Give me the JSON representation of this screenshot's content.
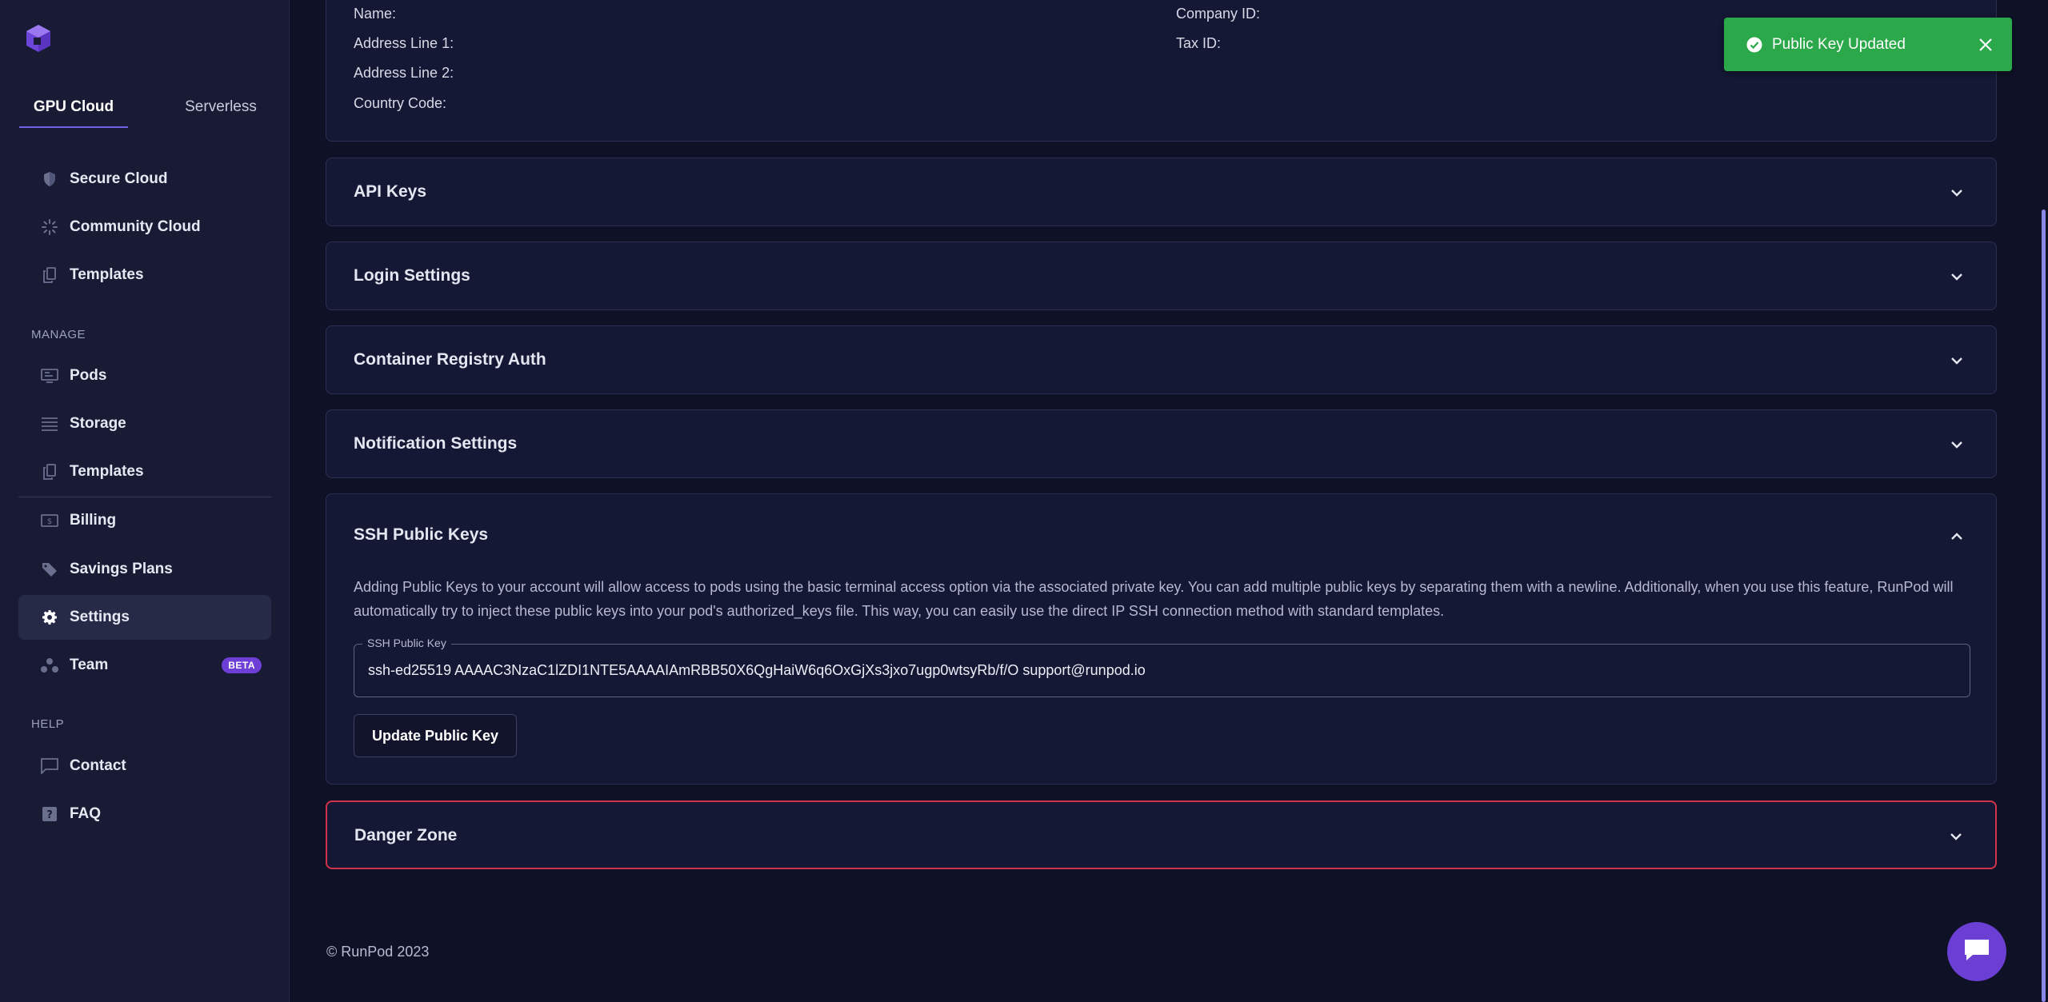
{
  "sidebar": {
    "tabs": [
      {
        "label": "GPU Cloud",
        "active": true
      },
      {
        "label": "Serverless",
        "active": false
      }
    ],
    "cloud_items": [
      {
        "label": "Secure Cloud",
        "icon": "shield-icon"
      },
      {
        "label": "Community Cloud",
        "icon": "community-icon"
      },
      {
        "label": "Templates",
        "icon": "templates-icon"
      }
    ],
    "manage_label": "MANAGE",
    "manage_items": [
      {
        "label": "Pods",
        "icon": "pods-icon"
      },
      {
        "label": "Storage",
        "icon": "storage-icon"
      },
      {
        "label": "Templates",
        "icon": "templates-icon"
      }
    ],
    "account_items": [
      {
        "label": "Billing",
        "icon": "billing-icon"
      },
      {
        "label": "Savings Plans",
        "icon": "tag-icon"
      },
      {
        "label": "Settings",
        "icon": "gear-icon",
        "active": true
      },
      {
        "label": "Team",
        "icon": "team-icon",
        "badge": "BETA"
      }
    ],
    "help_label": "HELP",
    "help_items": [
      {
        "label": "Contact",
        "icon": "chat-icon"
      },
      {
        "label": "FAQ",
        "icon": "question-icon"
      }
    ]
  },
  "billing_info": {
    "name_label": "Name:",
    "address1_label": "Address Line 1:",
    "address2_label": "Address Line 2:",
    "country_label": "Country Code:",
    "company_label": "Company ID:",
    "tax_label": "Tax ID:"
  },
  "sections": {
    "api_keys": "API Keys",
    "login_settings": "Login Settings",
    "container_registry": "Container Registry Auth",
    "notification_settings": "Notification Settings",
    "ssh": {
      "title": "SSH Public Keys",
      "description": "Adding Public Keys to your account will allow access to pods using the basic terminal access option via the associated private key. You can add multiple public keys by separating them with a newline. Additionally, when you use this feature, RunPod will automatically try to inject these public keys into your pod's authorized_keys file. This way, you can easily use the direct IP SSH connection method with standard templates.",
      "field_label": "SSH Public Key",
      "field_value": "ssh-ed25519 AAAAC3NzaC1lZDI1NTE5AAAAIAmRBB50X6QgHaiW6q6OxGjXs3jxo7ugp0wtsyRb/f/O support@runpod.io",
      "button_label": "Update Public Key"
    },
    "danger_zone": "Danger Zone"
  },
  "footer": "© RunPod 2023",
  "toast": {
    "message": "Public Key Updated",
    "color": "#2aa84a"
  },
  "colors": {
    "accent": "#6e62e5",
    "danger": "#d0334a",
    "chat": "#6b3fd3"
  }
}
